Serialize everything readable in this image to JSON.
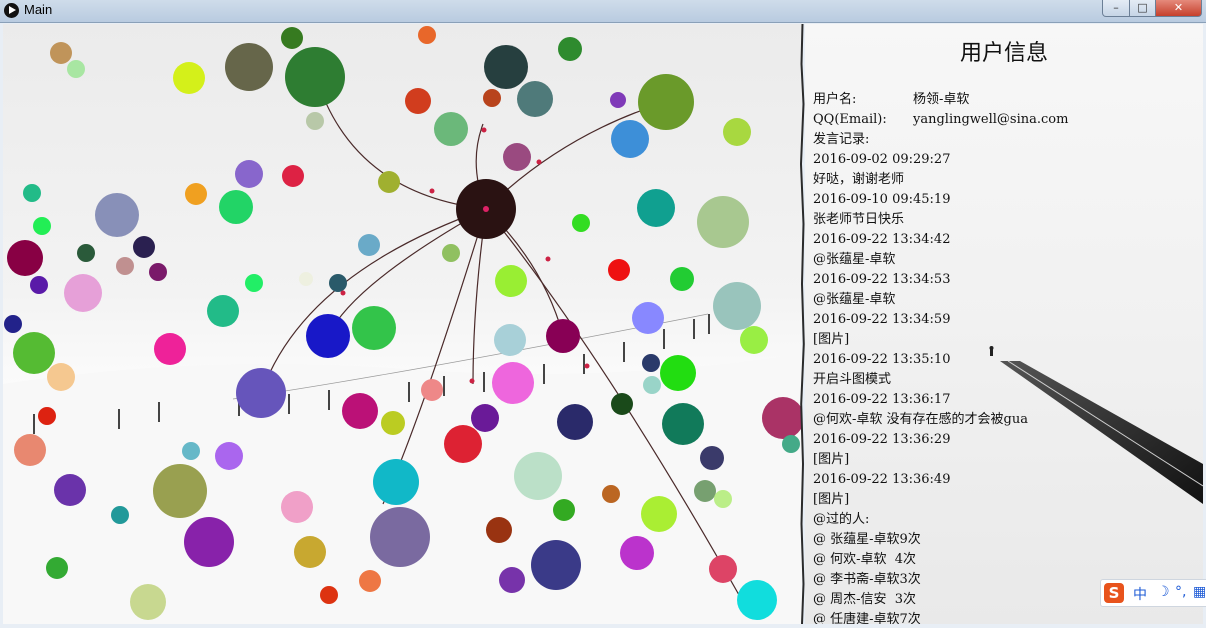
{
  "window": {
    "title": "Main",
    "minimize": "–",
    "maximize": "□",
    "close": "✕"
  },
  "user_panel": {
    "title": "用户信息",
    "username_label": "用户名:",
    "username": "杨领-卓软",
    "email_label": "QQ(Email):",
    "email": "yanglingwell@sina.com",
    "history_label": "发言记录:",
    "messages": [
      {
        "time": "2016-09-02 09:29:27",
        "text": "好哒，谢谢老师"
      },
      {
        "time": "2016-09-10 09:45:19",
        "text": "张老师节日快乐"
      },
      {
        "time": "2016-09-22 13:34:42",
        "text": "@张蕴星-卓软"
      },
      {
        "time": "2016-09-22 13:34:53",
        "text": "@张蕴星-卓软"
      },
      {
        "time": "2016-09-22 13:34:59",
        "text": "[图片]"
      },
      {
        "time": "2016-09-22 13:35:10",
        "text": "开启斗图模式"
      },
      {
        "time": "2016-09-22 13:36:17",
        "text": "@何欢-卓软 没有存在感的才会被gua"
      },
      {
        "time": "2016-09-22 13:36:29",
        "text": "[图片]"
      },
      {
        "time": "2016-09-22 13:36:49",
        "text": "[图片]"
      }
    ],
    "mentioned_label": "@过的人:",
    "mentioned": [
      "@ 张蕴星-卓软9次",
      "@ 何欢-卓软  4次",
      "@ 李书斋-卓软3次",
      "@ 周杰-信安  3次",
      "@ 任唐建-卓软7次"
    ]
  },
  "ime": {
    "logo": "S",
    "mode": "中",
    "moon": "☽",
    "punct": "°,",
    "grid": "▦"
  }
}
